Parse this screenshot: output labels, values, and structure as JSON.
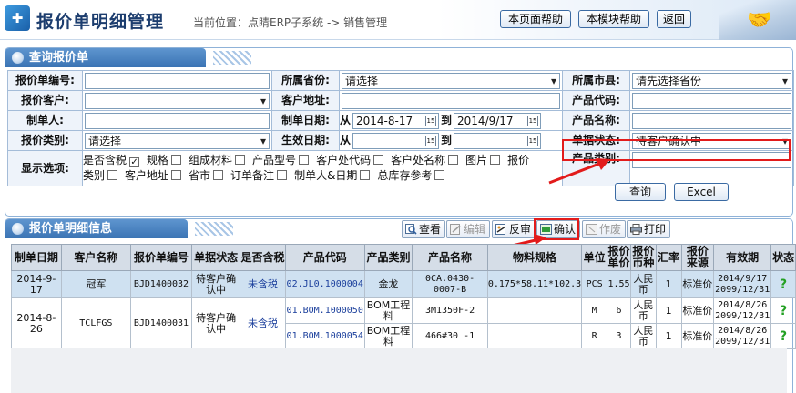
{
  "header": {
    "logo": "✚",
    "title": "报价单明细管理",
    "breadcrumb": "当前位置：点睛ERP子系统 -> 销售管理",
    "buttons": {
      "page_help": "本页面帮助",
      "module_help": "本模块帮助",
      "back": "返回"
    }
  },
  "query_panel": {
    "title": "查询报价单",
    "labels": {
      "quote_no": "报价单编号:",
      "province": "所属省份:",
      "city": "所属市县:",
      "customer": "报价客户:",
      "address": "客户地址:",
      "product_code": "产品代码:",
      "creator": "制单人:",
      "created_date": "制单日期:",
      "product_name": "产品名称:",
      "category": "报价类别:",
      "effective_date": "生效日期:",
      "doc_status": "单据状态:",
      "display_options": "显示选项:",
      "product_class": "产品类别:"
    },
    "values": {
      "province": "请选择",
      "city": "请先选择省份",
      "category": "请选择",
      "date_from_label": "从",
      "date_to_label": "到",
      "created_from": "2014-8-17",
      "created_to": "2014/9/17",
      "doc_status": "待客户确认中"
    },
    "options_line1": [
      {
        "label": "是否含税",
        "checked": true
      },
      {
        "label": "规格",
        "checked": false
      },
      {
        "label": "组成材料",
        "checked": false
      },
      {
        "label": "产品型号",
        "checked": false
      },
      {
        "label": "客户处代码",
        "checked": false
      },
      {
        "label": "客户处名称",
        "checked": false
      },
      {
        "label": "图片",
        "checked": false
      },
      {
        "label": "报价",
        "checked": false
      }
    ],
    "options_line2": [
      {
        "label": "类别",
        "checked": false
      },
      {
        "label": "客户地址",
        "checked": false
      },
      {
        "label": "省市",
        "checked": false
      },
      {
        "label": "订单备注",
        "checked": false
      },
      {
        "label": "制单人&日期",
        "checked": false
      },
      {
        "label": "总库存参考",
        "checked": false
      }
    ],
    "buttons": {
      "search": "查询",
      "excel": "Excel"
    }
  },
  "detail_panel": {
    "title": "报价单明细信息",
    "toolbar": {
      "view": "查看",
      "edit": "编辑",
      "reverse": "反审",
      "confirm": "确认",
      "void": "作废",
      "print": "打印"
    },
    "columns": [
      "制单日期",
      "客户名称",
      "报价单编号",
      "单据状态",
      "是否含税",
      "产品代码",
      "产品类别",
      "产品名称",
      "物料规格",
      "单位",
      "报价单价",
      "报价币种",
      "汇率",
      "报价来源",
      "有效期",
      "状态"
    ],
    "rows": [
      {
        "date": "2014-9-17",
        "customer": "冠军",
        "quote_no": "BJD1400032",
        "status": "待客户确认中",
        "tax": "未含税",
        "code": "02.JL0.1000004",
        "class": "金龙",
        "name": "0CA.0430-0007-B",
        "spec": "0.175*58.11*102.3",
        "unit": "PCS",
        "price": "1.55",
        "currency": "人民币",
        "rate": "1",
        "source": "标准价",
        "validity": "2014/9/17 2099/12/31",
        "state": "?"
      },
      {
        "date": "2014-8-26",
        "customer": "TCLFGS",
        "quote_no": "BJD1400031",
        "status": "待客户确认中",
        "tax": "未含税",
        "code": "01.BOM.1000050",
        "class": "BOM工程料",
        "name": "3M1350F-2",
        "spec": "",
        "unit": "M",
        "price": "6",
        "currency": "人民币",
        "rate": "1",
        "source": "标准价",
        "validity": "2014/8/26 2099/12/31",
        "state": "?"
      },
      {
        "code": "01.BOM.1000054",
        "class": "BOM工程料",
        "name": "466#30 -1",
        "spec": "",
        "unit": "R",
        "price": "3",
        "currency": "人民币",
        "rate": "1",
        "source": "标准价",
        "validity": "2014/8/26 2099/12/31",
        "state": "?"
      }
    ]
  },
  "colors": {
    "panel_header": "#3b74b4",
    "highlight": "#e21b1b",
    "selected_row": "#cfe1f1"
  }
}
